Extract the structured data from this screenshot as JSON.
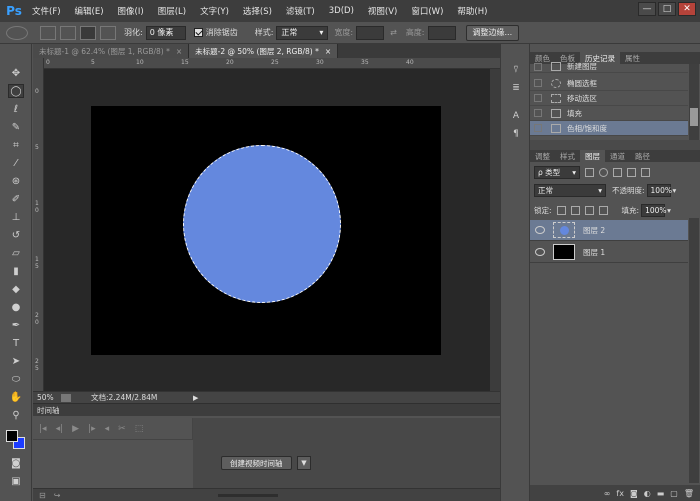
{
  "app": {
    "logo": "Ps"
  },
  "menu": [
    "文件(F)",
    "编辑(E)",
    "图像(I)",
    "图层(L)",
    "文字(Y)",
    "选择(S)",
    "滤镜(T)",
    "3D(D)",
    "视图(V)",
    "窗口(W)",
    "帮助(H)"
  ],
  "window_controls": {
    "minimize": "—",
    "maximize": "□",
    "close": "✕"
  },
  "options_bar": {
    "feather_label": "羽化:",
    "feather_value": "0 像素",
    "antialias_label": "消除锯齿",
    "style_label": "样式:",
    "style_value": "正常",
    "width_label": "宽度:",
    "height_label": "高度:",
    "refine_edge_button": "调整边缘..."
  },
  "document_tabs": [
    {
      "label": "未标题-1 @ 62.4% (图层 1, RGB/8) *",
      "close": "×"
    },
    {
      "label": "未标题-2 @ 50% (图层 2, RGB/8) *",
      "close": "×"
    }
  ],
  "rulers": {
    "h": [
      "0",
      "5",
      "10",
      "15",
      "20",
      "25",
      "30",
      "35",
      "40"
    ],
    "v": [
      "0",
      "5",
      "1 0",
      "1 5",
      "2 0",
      "2 5"
    ]
  },
  "status": {
    "zoom": "50%",
    "doc_info": "文档:2.24M/2.84M",
    "arrow": "▶"
  },
  "timeline": {
    "title": "时间轴",
    "create_button": "创建视频时间轴",
    "create_arrow": "▼",
    "controls": [
      "|◂",
      "◂|",
      "▶",
      "|▸",
      "◂",
      "✂",
      "⬚"
    ],
    "foot_icons": [
      "⊟",
      "↪"
    ]
  },
  "history_panel": {
    "tabs": [
      "颜色",
      "色板",
      "历史记录",
      "属性"
    ],
    "active_tab": "历史记录",
    "items": [
      {
        "label": "新建图层"
      },
      {
        "label": "椭圆选框"
      },
      {
        "label": "移动选区"
      },
      {
        "label": "填充"
      },
      {
        "label": "色相/饱和度"
      }
    ],
    "selected_index": 4
  },
  "layers_panel": {
    "tabs": [
      "调整",
      "样式",
      "图层",
      "通道",
      "路径"
    ],
    "active_tab": "图层",
    "filter_label": "ρ 类型",
    "blend_mode": "正常",
    "opacity_label": "不透明度:",
    "opacity_value": "100%",
    "lock_label": "锁定:",
    "fill_label": "填充:",
    "fill_value": "100%",
    "layers": [
      {
        "name": "图层 2",
        "selected": true
      },
      {
        "name": "图层 1",
        "selected": false
      }
    ],
    "footer_icons": [
      "∞",
      "fx",
      "◙",
      "◐",
      "▬",
      "▢",
      "🗑"
    ]
  },
  "canvas": {
    "background": "#000000",
    "circle_color": "#6488de"
  },
  "colors": {
    "foreground": "#000000",
    "background": "#1c3cff",
    "selection": "#6b7a93"
  }
}
